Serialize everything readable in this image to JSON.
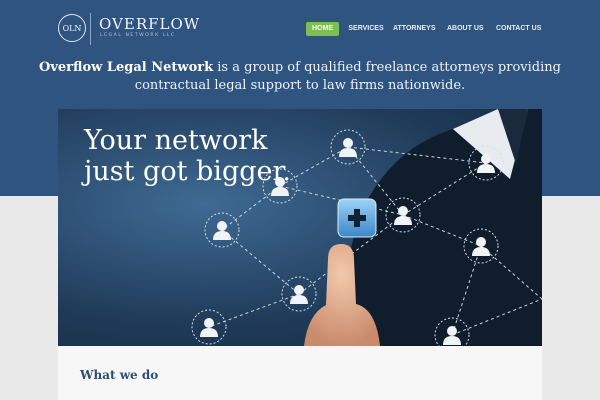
{
  "brand": {
    "logo_text": "OLN",
    "name": "OVERFLOW",
    "tagline": "LEGAL NETWORK LLC"
  },
  "nav": {
    "items": [
      {
        "label": "HOME",
        "active": true
      },
      {
        "label": "SERVICES",
        "active": false
      },
      {
        "label": "ATTORNEYS",
        "active": false
      },
      {
        "label": "ABOUT US",
        "active": false
      },
      {
        "label": "CONTACT US",
        "active": false
      }
    ]
  },
  "intro": {
    "company": "Overflow Legal Network",
    "line1_rest": " is a group of qualified freelance attorneys providing",
    "line2": "contractual legal support to law firms nationwide."
  },
  "hero": {
    "headline_line1": "Your network",
    "headline_line2": "just got bigger."
  },
  "section": {
    "title": "What we do"
  },
  "colors": {
    "header_bg": "#2f5480",
    "active_nav": "#7cbf52",
    "section_title": "#2c4e76",
    "page_bg": "#e9e9e9"
  },
  "icons": [
    "oln-logo-icon",
    "plus-icon",
    "person-icon"
  ]
}
